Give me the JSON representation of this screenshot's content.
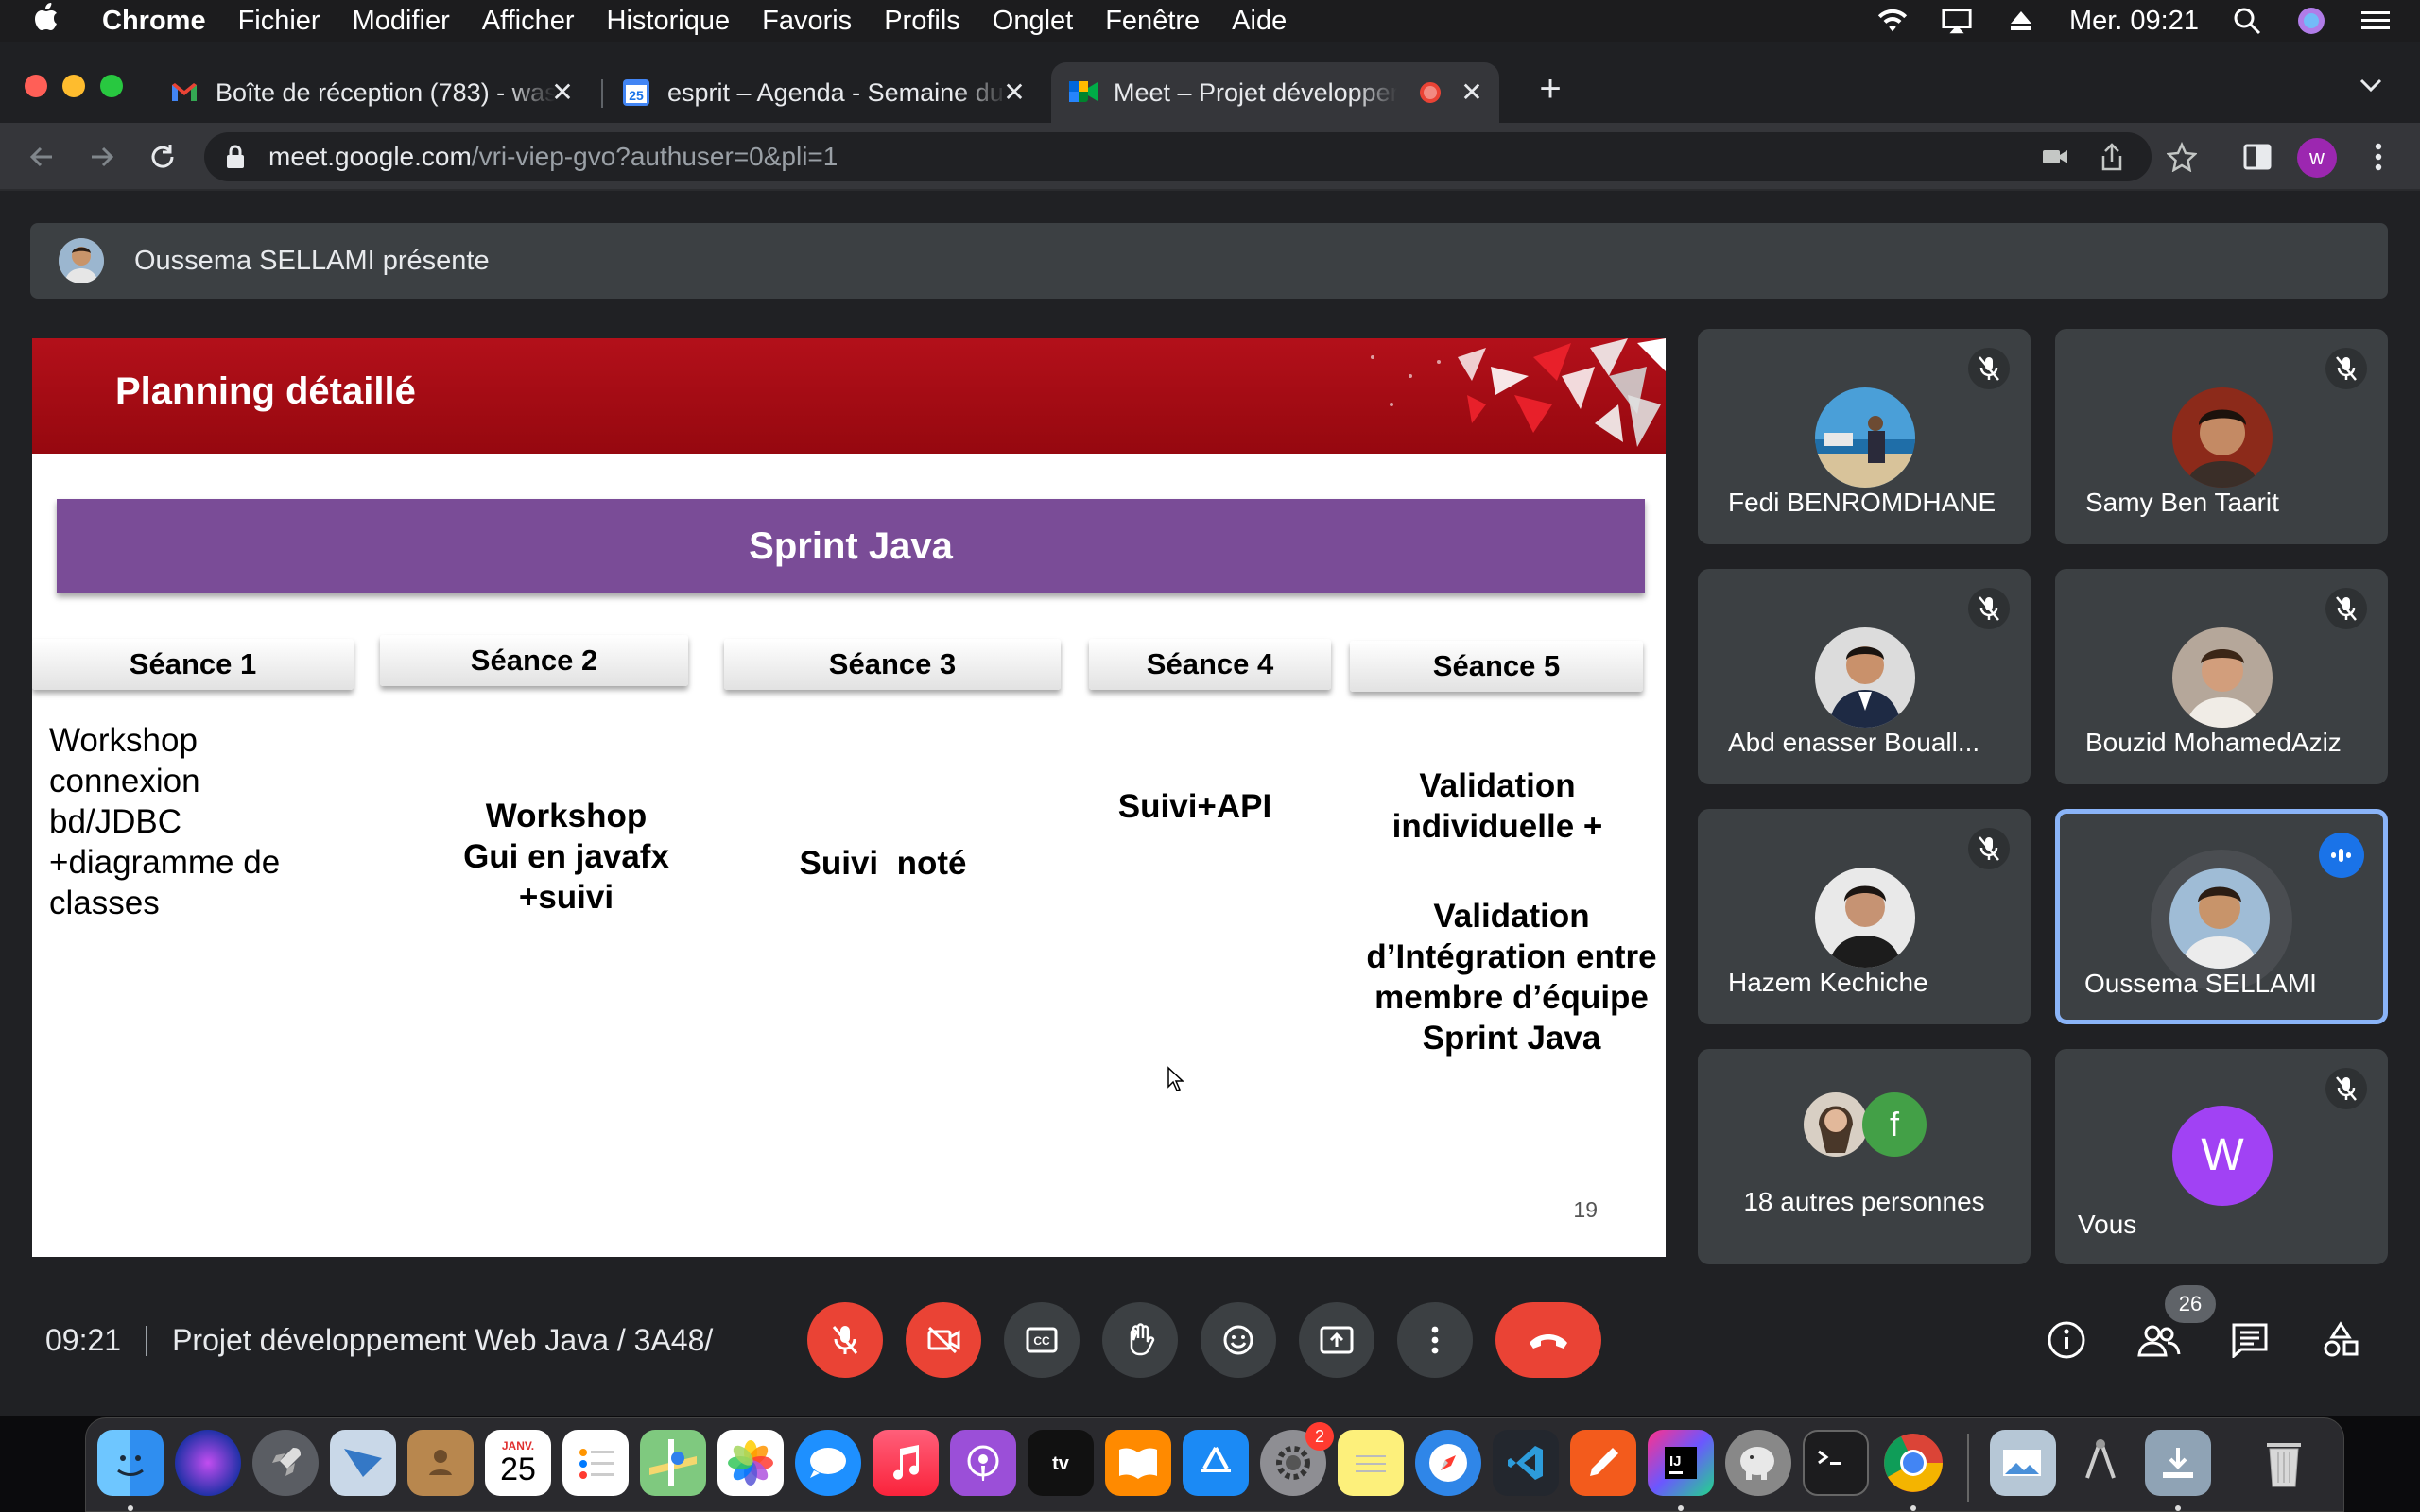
{
  "menubar": {
    "app_name": "Chrome",
    "items": [
      "Fichier",
      "Modifier",
      "Afficher",
      "Historique",
      "Favoris",
      "Profils",
      "Onglet",
      "Fenêtre",
      "Aide"
    ],
    "clock": "Mer. 09:21"
  },
  "tabs": [
    {
      "title": "Boîte de réception (783) - wass",
      "icon": "gmail-icon"
    },
    {
      "title": "esprit – Agenda - Semaine du 2",
      "icon": "calendar-icon",
      "icon_text": "25"
    },
    {
      "title": "Meet – Projet développement",
      "icon": "meet-icon",
      "active": true
    }
  ],
  "toolbar": {
    "url_host": "meet.google.com",
    "url_path": "/vri-viep-gvo?authuser=0&pli=1",
    "profile_initial": "w"
  },
  "meet": {
    "presenting_text": "Oussema SELLAMI présente",
    "slide": {
      "title": "Planning détaillé",
      "banner": "Sprint Java",
      "sessions": [
        "Séance 1",
        "Séance 2",
        "Séance 3",
        "Séance 4",
        "Séance 5"
      ],
      "s1_text": [
        "Workshop",
        "connexion",
        "bd/JDBC",
        "+diagramme de",
        "classes"
      ],
      "s2_text": [
        "Workshop",
        "Gui en javafx",
        "+suivi"
      ],
      "s3_text": "Suivi  noté",
      "s4_text": "Suivi+API",
      "s5_text_a": [
        "Validation",
        "individuelle +"
      ],
      "s5_text_b": [
        "Validation",
        "d’Intégration entre",
        "membre d’équipe",
        "Sprint Java"
      ],
      "page_number": "19"
    },
    "participants": [
      {
        "name": "Fedi BENROMDHANE",
        "muted": true
      },
      {
        "name": "Samy Ben Taarit",
        "muted": true
      },
      {
        "name": "Abd enasser Bouall...",
        "muted": true
      },
      {
        "name": "Bouzid MohamedAziz",
        "muted": true
      },
      {
        "name": "Hazem Kechiche",
        "muted": true
      },
      {
        "name": "Oussema SELLAMI",
        "speaking": true
      },
      {
        "name": "18 autres personnes",
        "avatar_letter": "f"
      },
      {
        "name": "Vous",
        "avatar_letter": "W",
        "muted": true
      }
    ],
    "footer": {
      "time": "09:21",
      "meeting_title": "Projet développement Web Java / 3A48/",
      "participant_count": "26"
    }
  },
  "dock": {
    "calendar_month": "JANV.",
    "calendar_day": "25",
    "settings_badge": "2"
  },
  "colors": {
    "slide_red": "#a50c14",
    "banner_purple": "#7a4c97",
    "meet_bg": "#202124",
    "tile_bg": "#3c4043",
    "end_call_red": "#ea4335",
    "speaking_blue": "#8ab4f8"
  }
}
